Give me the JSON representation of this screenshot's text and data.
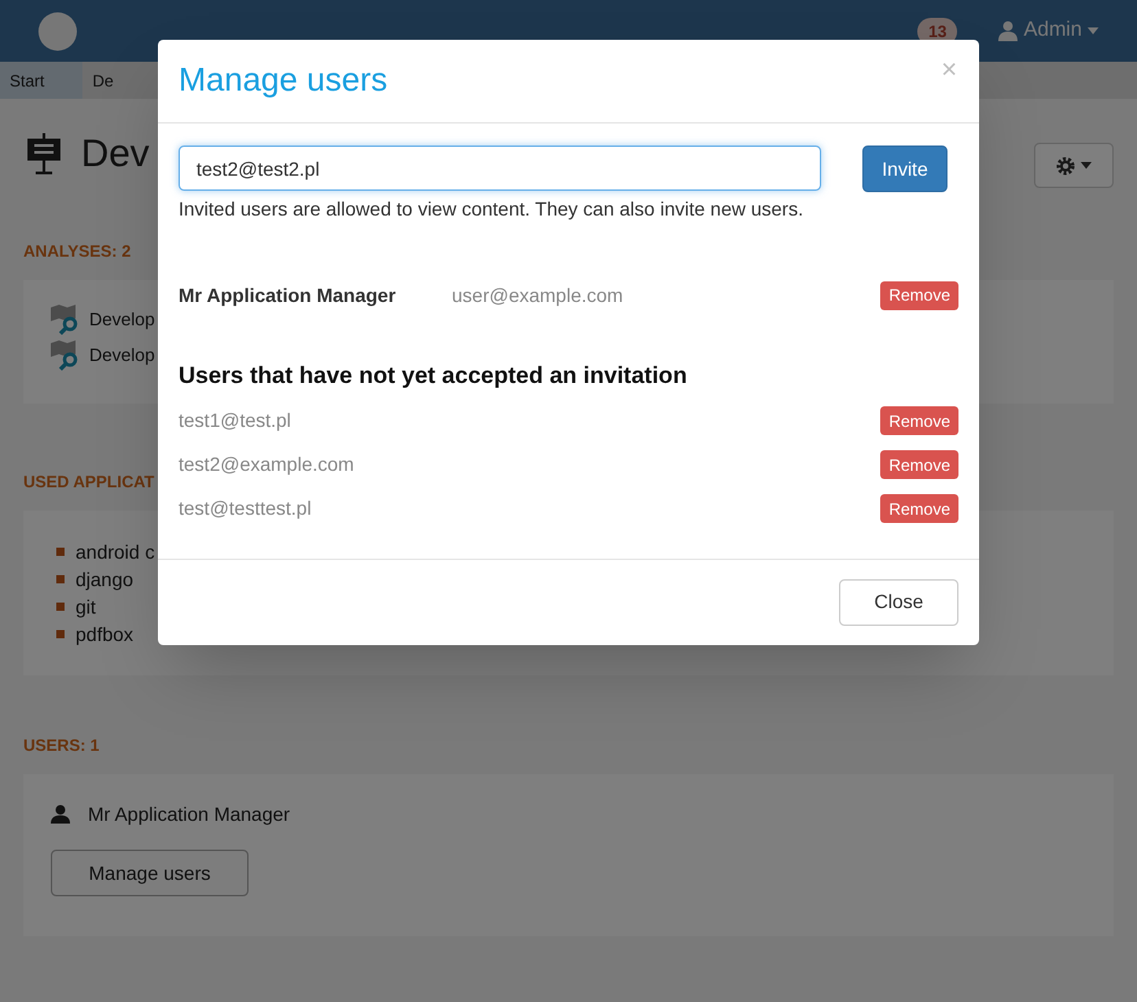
{
  "navbar": {
    "notification_count": "13",
    "user": "Admin"
  },
  "breadcrumb": [
    {
      "label": "Start"
    },
    {
      "label": "De"
    }
  ],
  "page": {
    "title": "Dev",
    "analyses": {
      "heading": "ANALYSES: 2",
      "items": [
        "Develop",
        "Develop"
      ]
    },
    "applications": {
      "heading": "USED APPLICAT",
      "items": [
        "android c",
        "django",
        "git",
        "pdfbox"
      ]
    },
    "users": {
      "heading": "USERS: 1",
      "items": [
        "Mr Application Manager"
      ],
      "button": "Manage users"
    }
  },
  "modal": {
    "title": "Manage users",
    "close_symbol": "×",
    "invite_value": "test2@test2.pl",
    "invite_button": "Invite",
    "help": "Invited users are allowed to view content. They can also invite new users.",
    "members": [
      {
        "name": "Mr Application Manager",
        "email": "user@example.com",
        "action": "Remove"
      }
    ],
    "pending_heading": "Users that have not yet accepted an invitation",
    "pending": [
      {
        "email": "test1@test.pl",
        "action": "Remove"
      },
      {
        "email": "test2@example.com",
        "action": "Remove"
      },
      {
        "email": "test@testtest.pl",
        "action": "Remove"
      }
    ],
    "footer_button": "Close"
  }
}
